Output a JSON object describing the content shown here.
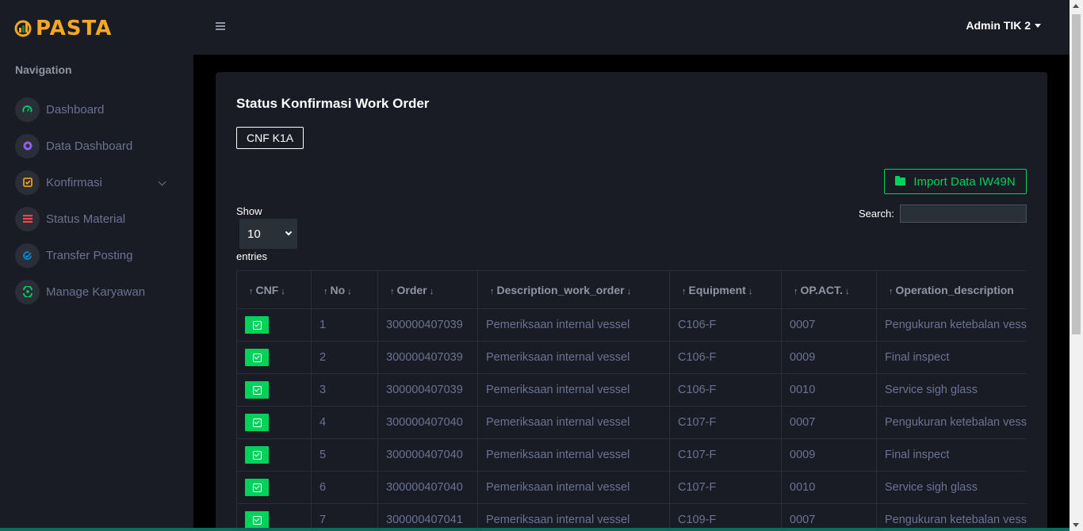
{
  "app": {
    "logo_text": "PASTA"
  },
  "sidebar": {
    "heading": "Navigation",
    "items": [
      {
        "label": "Dashboard",
        "icon": "speedometer-icon",
        "color": "#00d25b"
      },
      {
        "label": "Data Dashboard",
        "icon": "pie-chart-icon",
        "color": "#8f5fe8"
      },
      {
        "label": "Konfirmasi",
        "icon": "checkbox-icon",
        "color": "#ffab00",
        "has_submenu": true
      },
      {
        "label": "Status Material",
        "icon": "list-icon",
        "color": "#fc424a"
      },
      {
        "label": "Transfer Posting",
        "icon": "check-circle-icon",
        "color": "#0090e7"
      },
      {
        "label": "Manage Karyawan",
        "icon": "people-icon",
        "color": "#00d25b"
      }
    ]
  },
  "topbar": {
    "user": "Admin TIK 2"
  },
  "page": {
    "title": "Status Konfirmasi Work Order",
    "cnf_button": "CNF K1A",
    "import_button": "Import Data IW49N",
    "show_label": "Show",
    "entries_value": "10",
    "entries_label": "entries",
    "search_label": "Search:"
  },
  "table": {
    "columns": [
      "CNF",
      "No",
      "Order",
      "Description_work_order",
      "Equipment",
      "OP.ACT.",
      "Operation_description"
    ],
    "rows": [
      {
        "no": "1",
        "order": "300000407039",
        "desc": "Pemeriksaan internal vessel",
        "equipment": "C106-F",
        "opact": "0007",
        "operation": "Pengukuran ketebalan vessel"
      },
      {
        "no": "2",
        "order": "300000407039",
        "desc": "Pemeriksaan internal vessel",
        "equipment": "C106-F",
        "opact": "0009",
        "operation": "Final inspect"
      },
      {
        "no": "3",
        "order": "300000407039",
        "desc": "Pemeriksaan internal vessel",
        "equipment": "C106-F",
        "opact": "0010",
        "operation": "Service sigh glass"
      },
      {
        "no": "4",
        "order": "300000407040",
        "desc": "Pemeriksaan internal vessel",
        "equipment": "C107-F",
        "opact": "0007",
        "operation": "Pengukuran ketebalan vessel"
      },
      {
        "no": "5",
        "order": "300000407040",
        "desc": "Pemeriksaan internal vessel",
        "equipment": "C107-F",
        "opact": "0009",
        "operation": "Final inspect"
      },
      {
        "no": "6",
        "order": "300000407040",
        "desc": "Pemeriksaan internal vessel",
        "equipment": "C107-F",
        "opact": "0010",
        "operation": "Service sigh glass"
      },
      {
        "no": "7",
        "order": "300000407041",
        "desc": "Pemeriksaan internal vessel",
        "equipment": "C109-F",
        "opact": "0007",
        "operation": "Pengukuran ketebalan vessel"
      }
    ]
  },
  "colors": {
    "accent_green": "#00d25b",
    "logo": "#f5a623",
    "panel": "#191c24"
  }
}
